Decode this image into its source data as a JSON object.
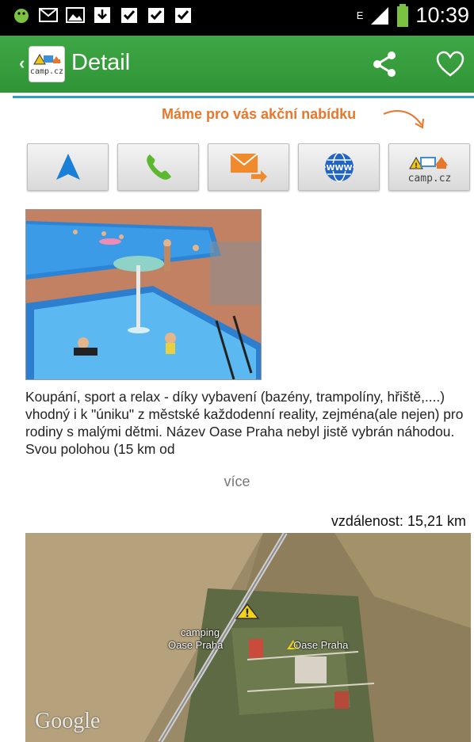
{
  "status_bar": {
    "time": "10:39",
    "network": "E",
    "icons": [
      "android-icon",
      "mail-icon",
      "image-icon",
      "download-icon",
      "checkbox-icon",
      "checkbox-icon",
      "checkbox-icon"
    ]
  },
  "action_bar": {
    "title": "Detail",
    "logo_text": "camp.cz",
    "actions": [
      "share-icon",
      "heart-icon"
    ]
  },
  "promo": {
    "text": "Máme pro vás akční nabídku"
  },
  "action_buttons": [
    {
      "name": "navigate",
      "icon": "navigation-arrow-icon",
      "color": "#1a7fd6"
    },
    {
      "name": "call",
      "icon": "phone-icon",
      "color": "#5cb82e"
    },
    {
      "name": "email",
      "icon": "email-icon",
      "color": "#f08a2c"
    },
    {
      "name": "web",
      "icon": "globe-www-icon",
      "color": "#1f64c8"
    },
    {
      "name": "campcz",
      "icon": "camp-logo-icon",
      "label": "camp.cz"
    }
  ],
  "description": {
    "text": "Koupání, sport a relax - díky vybavení (bazény, trampolíny, hřiště,....) vhodný i k \"úniku\" z městské každodenní reality, zejména(ale nejen) pro rodiny s malými dětmi.  Název Oase Praha nebyl jistě vybrán náhodou. Svou polohou  (15 km od",
    "more_label": "více"
  },
  "distance": {
    "label": "vzdálenost:",
    "value": "15,21 km"
  },
  "map": {
    "marker_label_1": "camping",
    "marker_label_2": "Oase Praha",
    "place_label": "Oase Praha",
    "watermark": "Google"
  },
  "colors": {
    "action_bar": "#3fa746",
    "divider": "#2aa0c8",
    "promo": "#e8772b"
  }
}
